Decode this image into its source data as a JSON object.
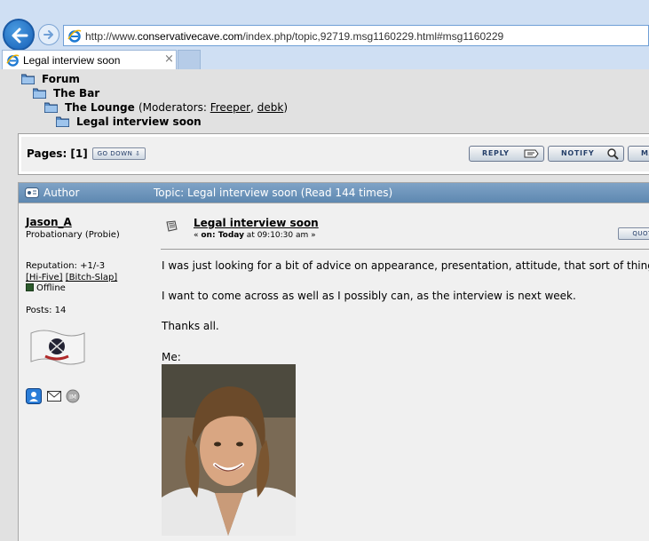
{
  "browser": {
    "url_prefix": "http://www.",
    "url_domain": "conservativecave.com",
    "url_path": "/index.php/topic,92719.msg1160229.html#msg1160229",
    "tab_title": "Legal interview soon",
    "tab_close": "×"
  },
  "breadcrumb": {
    "forum": "Forum",
    "bar": "The Bar",
    "lounge": "The Lounge",
    "moderators_prefix": "(Moderators: ",
    "moderator_1": "Freeper",
    "moderator_sep": ", ",
    "moderator_2": "debk",
    "moderators_suffix": ")",
    "topic": "Legal interview soon"
  },
  "pages": {
    "label": "Pages: [1]",
    "go_down": "GO DOWN",
    "reply": "REPLY",
    "notify": "NOTIFY",
    "mark": "MARK"
  },
  "header": {
    "author": "Author",
    "topic": "Topic: Legal interview soon  (Read 144 times)"
  },
  "poster": {
    "name": "Jason_A",
    "rank": "Probationary (Probie)",
    "reputation": "Reputation: +1/-3",
    "hi_five": "[Hi-Five]",
    "bitch_slap": "[Bitch-Slap]",
    "status": "Offline",
    "posts": "Posts: 14"
  },
  "message": {
    "subject": "Legal interview soon",
    "date_prefix": "« ",
    "date_on": "on: Today",
    "date_time": " at 09:10:30 am »",
    "quote": "QUOTE",
    "line_1": "I was just looking for a bit of advice on appearance, presentation, attitude, that sort of thing.",
    "line_2": "I want to come across as well as I possibly can, as the interview is next week.",
    "line_3": "Thanks all.",
    "line_4": "Me:"
  },
  "colors": {
    "header_blue": "#6a91b8",
    "chrome_blue": "#cfdff3",
    "page_gray": "#e1e1e1"
  }
}
